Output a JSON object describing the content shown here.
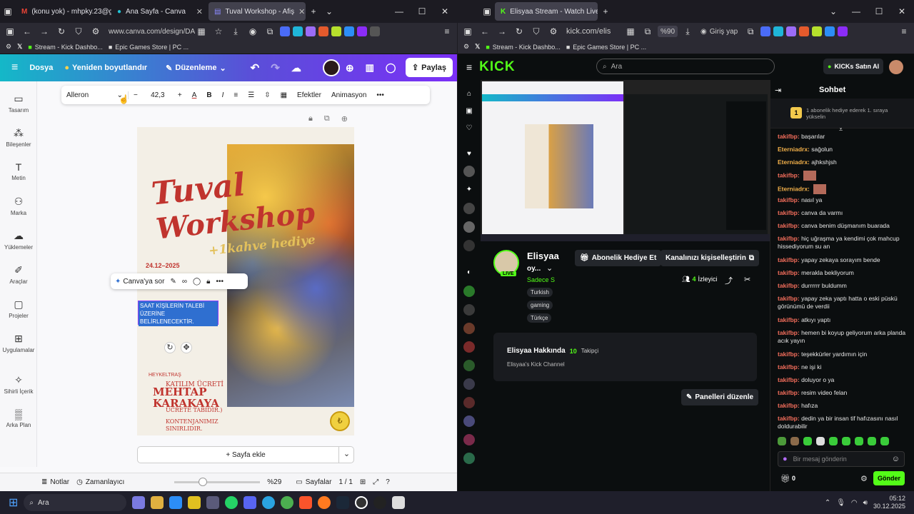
{
  "left": {
    "tabs": [
      {
        "label": "(konu yok) - mhpky.23@gm"
      },
      {
        "label": "Ana Sayfa - Canva"
      },
      {
        "label": "Tuval Workshop - Afiş"
      }
    ],
    "url": "www.canva.com/design/DA",
    "bookmarks": [
      {
        "label": "Stream - Kick Dashbo..."
      },
      {
        "label": "Epic Games Store | PC ..."
      }
    ],
    "header": {
      "menu": "Dosya",
      "resize": "Yeniden boyutlandır",
      "edit": "Düzenleme",
      "share": "Paylaş"
    },
    "sidebar": [
      {
        "label": "Tasarım"
      },
      {
        "label": "Bileşenler"
      },
      {
        "label": "Metin"
      },
      {
        "label": "Marka"
      },
      {
        "label": "Yüklemeler"
      },
      {
        "label": "Araçlar"
      },
      {
        "label": "Projeler"
      },
      {
        "label": "Uygulamalar"
      },
      {
        "label": "Sihirli İçerik"
      },
      {
        "label": "Arka Plan"
      }
    ],
    "toolbar": {
      "font": "Alleron",
      "size": "42,3",
      "effects": "Efektler",
      "animation": "Animasyon"
    },
    "poster": {
      "title1": "Tuval",
      "title2": "Workshop",
      "subtitle": "+1kahve hediye",
      "date": "24.12–2025",
      "sel_text": "SAAT KİŞİLERİN TALEBİ ÜZERİNE BELİRLENECEKTİR.",
      "lower1": "HEYKELTRAŞ",
      "lower2": "MEHTAP",
      "lower3": "KARAKAYA",
      "lower4": "KATILIM ÜCRETİ",
      "lower5": "ÜCRETE TABİDİR.)",
      "lower6": "KONTENJANIMIZ SINIRLIDIR."
    },
    "ask": "Canva'ya sor",
    "addpage": "+ Sayfa ekle",
    "footer": {
      "notes": "Notlar",
      "timer": "Zamanlayıcı",
      "zoom": "%29",
      "pages": "Sayfalar",
      "pageno": "1 / 1"
    }
  },
  "right": {
    "tabs": [
      {
        "label": "Elisyaa Stream - Watch Live on"
      }
    ],
    "url": "kick.com/elis",
    "zoom": "%90",
    "login": "Giriş yap",
    "bookmarks": [
      {
        "label": "Stream - Kick Dashbo..."
      },
      {
        "label": "Epic Games Store | PC ..."
      }
    ],
    "search": "Ara",
    "kicks": "KICKs Satın Al",
    "channel": {
      "name": "Elisyaa",
      "status": "oy...",
      "tag_sub": "Sadece S",
      "live": "LIVE",
      "tags": [
        "Turkish",
        "gaming",
        "Türkçe"
      ],
      "viewers": "4",
      "viewers_label": "İzleyici",
      "gift": "Abonelik Hediye Et",
      "customize": "Kanalınızı kişiselleştirin",
      "about_title": "Elisyaa Hakkında",
      "followers": "10",
      "followers_label": "Takipçi",
      "bio": "Elisyaa's Kick Channel",
      "panels": "Panelleri düzenle"
    },
    "chat": {
      "title": "Sohbet",
      "gift_note": "1 abonelik hediye ederek 1. sıraya yükselin",
      "placeholder": "Bir mesaj gönderin",
      "send": "Gönder",
      "points": "0",
      "messages": [
        {
          "user": "takifbp:",
          "text": "başarılar",
          "color": "#f26d5b"
        },
        {
          "user": "Eterniadrx:",
          "text": "sağolun",
          "color": "#f2b04a"
        },
        {
          "user": "Eterniadrx:",
          "text": "ajhkshjsh",
          "color": "#f2b04a"
        },
        {
          "user": "takifbp:",
          "text": "",
          "color": "#f26d5b"
        },
        {
          "user": "Eterniadrx:",
          "text": "",
          "color": "#f2b04a"
        },
        {
          "user": "takifbp:",
          "text": "nasıl ya",
          "color": "#f26d5b"
        },
        {
          "user": "takifbp:",
          "text": "canva da varmı",
          "color": "#f26d5b"
        },
        {
          "user": "takifbp:",
          "text": "canva benim düşmanım buarada",
          "color": "#f26d5b"
        },
        {
          "user": "takifbp:",
          "text": "hiç uğraşma ya kendimi çok mahcup hissediyorum su an",
          "color": "#f26d5b"
        },
        {
          "user": "takifbp:",
          "text": "yapay zekaya sorayım bende",
          "color": "#f26d5b"
        },
        {
          "user": "takifbp:",
          "text": "merakla bekliyorum",
          "color": "#f26d5b"
        },
        {
          "user": "takifbp:",
          "text": "durrrrrr buldumm",
          "color": "#f26d5b"
        },
        {
          "user": "takifbp:",
          "text": "yapay zeka yaptı hatta o eski püskü görünümü de verdii",
          "color": "#f26d5b"
        },
        {
          "user": "takifbp:",
          "text": "atkıyı yaptı",
          "color": "#f26d5b"
        },
        {
          "user": "takifbp:",
          "text": "hemen bi koyup geliyorum arka planda acık yayın",
          "color": "#f26d5b"
        },
        {
          "user": "takifbp:",
          "text": "teşekkürler yardımın için",
          "color": "#f26d5b"
        },
        {
          "user": "takifbp:",
          "text": "ne işi ki",
          "color": "#f26d5b"
        },
        {
          "user": "takifbp:",
          "text": "doluyor o ya",
          "color": "#f26d5b"
        },
        {
          "user": "takifbp:",
          "text": "resim video felan",
          "color": "#f26d5b"
        },
        {
          "user": "takifbp:",
          "text": "hafıza",
          "color": "#f26d5b"
        },
        {
          "user": "takifbp:",
          "text": "dedin ya bir insan tif hafızasını nasıl doldurabilir",
          "color": "#f26d5b"
        }
      ]
    }
  },
  "taskbar": {
    "search": "Ara",
    "time": "05:12",
    "date": "30.12.2025"
  }
}
